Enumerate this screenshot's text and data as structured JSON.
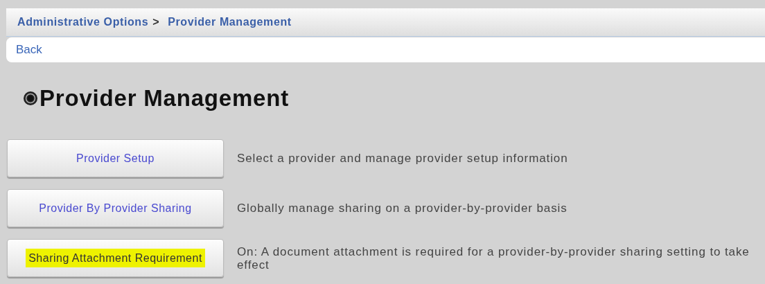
{
  "breadcrumb": {
    "items": [
      "Administrative Options",
      "Provider Management"
    ],
    "separator": ">"
  },
  "back_link": "Back",
  "heading": "Provider Management",
  "options": [
    {
      "label": "Provider Setup",
      "description": "Select a provider and manage provider setup information",
      "highlighted": false
    },
    {
      "label": "Provider By Provider Sharing",
      "description": "Globally manage sharing on a provider-by-provider basis",
      "highlighted": false
    },
    {
      "label": "Sharing Attachment Requirement",
      "description": "On: A document attachment is required for a provider-by-provider sharing setting to take effect",
      "highlighted": true
    }
  ]
}
